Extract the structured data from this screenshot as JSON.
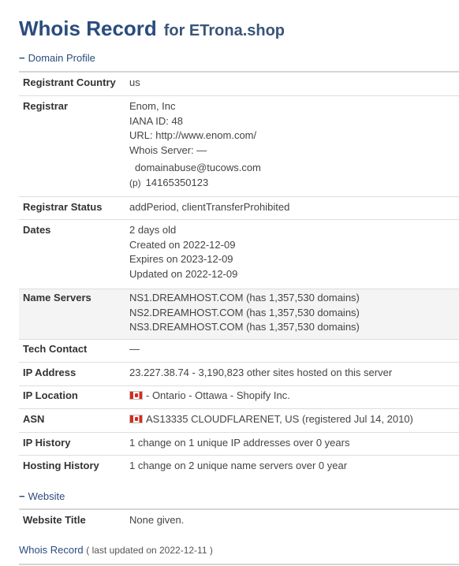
{
  "header": {
    "title": "Whois Record",
    "subtitle": "for ETrona.shop"
  },
  "domain_profile": {
    "heading": "Domain Profile",
    "rows": {
      "registrant_country": {
        "label": "Registrant Country",
        "value": "us"
      },
      "registrar": {
        "label": "Registrar",
        "name": "Enom, Inc",
        "iana": "IANA ID: 48",
        "url": "URL: http://www.enom.com/",
        "whois_server": "Whois Server: —",
        "email": "domainabuse@tucows.com",
        "phone_tag": "(p)",
        "phone": "14165350123"
      },
      "registrar_status": {
        "label": "Registrar Status",
        "value": "addPeriod, clientTransferProhibited"
      },
      "dates": {
        "label": "Dates",
        "age": "2 days old",
        "created": "Created on 2022-12-09",
        "expires": "Expires on 2023-12-09",
        "updated": "Updated on 2022-12-09"
      },
      "name_servers": {
        "label": "Name Servers",
        "ns1": "NS1.DREAMHOST.COM (has 1,357,530 domains)",
        "ns2": "NS2.DREAMHOST.COM (has 1,357,530 domains)",
        "ns3": "NS3.DREAMHOST.COM (has 1,357,530 domains)"
      },
      "tech_contact": {
        "label": "Tech Contact",
        "value": "—"
      },
      "ip_address": {
        "label": "IP Address",
        "value": "23.227.38.74 - 3,190,823 other sites hosted on this server"
      },
      "ip_location": {
        "label": "IP Location",
        "value": "- Ontario - Ottawa - Shopify Inc.",
        "flag": "canada-flag"
      },
      "asn": {
        "label": "ASN",
        "value": "AS13335 CLOUDFLARENET, US (registered Jul 14, 2010)",
        "flag": "canada-flag"
      },
      "ip_history": {
        "label": "IP History",
        "value": "1 change on 1 unique IP addresses over 0 years"
      },
      "hosting_history": {
        "label": "Hosting History",
        "value": "1 change on 2 unique name servers over 0 year"
      }
    }
  },
  "website": {
    "heading": "Website",
    "rows": {
      "website_title": {
        "label": "Website Title",
        "value": "None given."
      }
    }
  },
  "footer": {
    "title": "Whois Record",
    "note": "( last updated on 2022-12-11 )"
  },
  "colors": {
    "heading": "#2b4c7e",
    "shaded_row": "#f4f4f4",
    "border": "#dddddd"
  }
}
